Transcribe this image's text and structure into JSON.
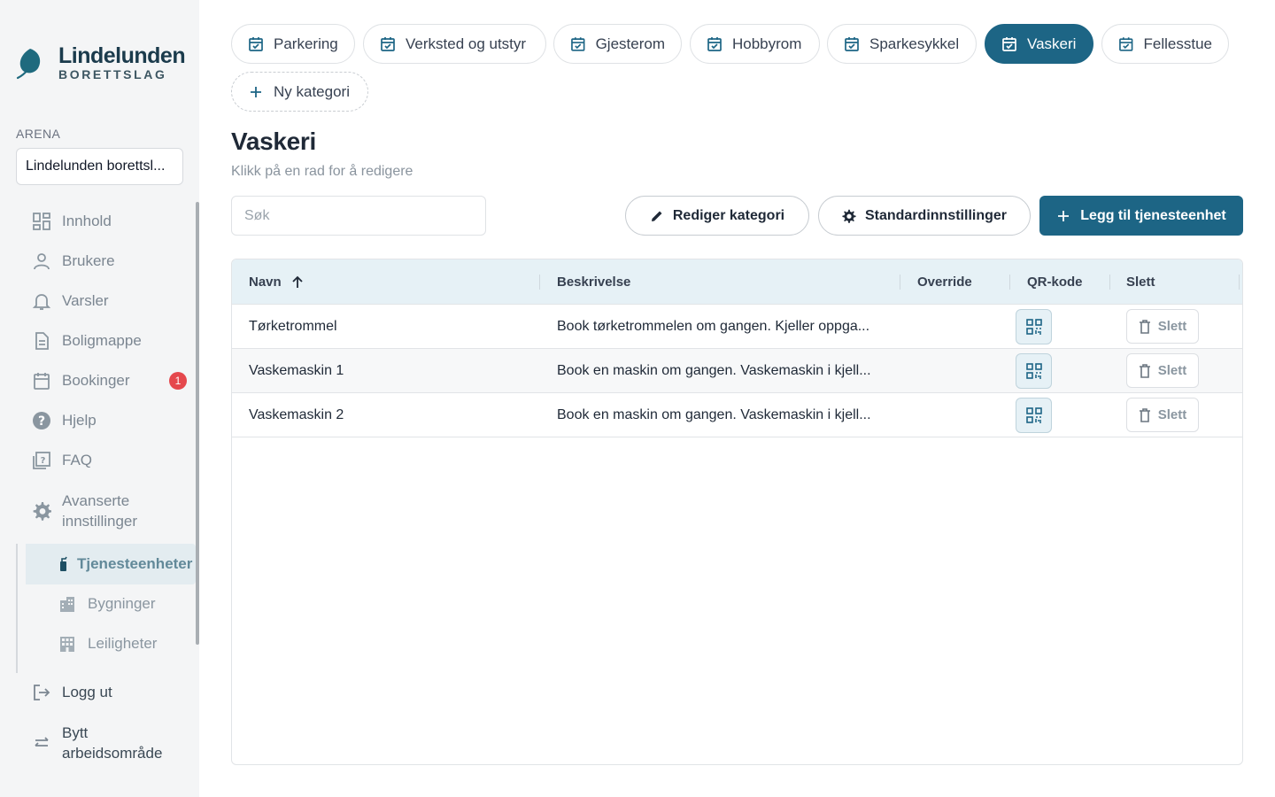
{
  "brand": {
    "name": "Lindelunden",
    "subtitle": "BORETTSLAG"
  },
  "sidebar": {
    "arena_label": "ARENA",
    "arena_value": "Lindelunden borettsl...",
    "items": [
      {
        "label": "Innhold",
        "icon": "dashboard-icon"
      },
      {
        "label": "Brukere",
        "icon": "user-icon"
      },
      {
        "label": "Varsler",
        "icon": "bell-icon"
      },
      {
        "label": "Boligmappe",
        "icon": "document-icon"
      },
      {
        "label": "Bookinger",
        "icon": "calendar-icon",
        "badge": "1"
      },
      {
        "label": "Hjelp",
        "icon": "help-icon"
      },
      {
        "label": "FAQ",
        "icon": "faq-icon"
      }
    ],
    "advanced": {
      "line1": "Avanserte",
      "line2": "innstillinger"
    },
    "sub_items": [
      {
        "label": "Tjenesteenheter",
        "active": true
      },
      {
        "label": "Bygninger"
      },
      {
        "label": "Leiligheter"
      }
    ],
    "logout": "Logg ut",
    "switch": {
      "line1": "Bytt",
      "line2": "arbeidsområde"
    }
  },
  "tabs": [
    {
      "label": "Parkering"
    },
    {
      "label": "Verksted og utstyr"
    },
    {
      "label": "Gjesterom"
    },
    {
      "label": "Hobbyrom"
    },
    {
      "label": "Sparkesykkel"
    },
    {
      "label": "Vaskeri",
      "active": true
    },
    {
      "label": "Fellesstue"
    }
  ],
  "new_category": "Ny kategori",
  "page": {
    "title": "Vaskeri",
    "subtitle": "Klikk på en rad for å redigere"
  },
  "search": {
    "placeholder": "Søk",
    "value": ""
  },
  "actions": {
    "edit_category": "Rediger kategori",
    "default_settings": "Standardinnstillinger",
    "add_unit": "Legg til tjenesteenhet"
  },
  "table": {
    "columns": [
      "Navn",
      "Beskrivelse",
      "Override",
      "QR-kode",
      "Slett"
    ],
    "sort": {
      "column": "Navn",
      "direction": "asc"
    },
    "delete_label": "Slett",
    "rows": [
      {
        "name": "Tørketrommel",
        "description": "Book tørketrommelen om gangen. Kjeller oppga...",
        "override": ""
      },
      {
        "name": "Vaskemaskin 1",
        "description": "Book en maskin om gangen. Vaskemaskin i kjell...",
        "override": ""
      },
      {
        "name": "Vaskemaskin 2",
        "description": "Book en maskin om gangen. Vaskemaskin i kjell...",
        "override": ""
      }
    ]
  },
  "colors": {
    "primary": "#1d6585",
    "header_bg": "#e6f1f6",
    "badge": "#e5484d"
  }
}
